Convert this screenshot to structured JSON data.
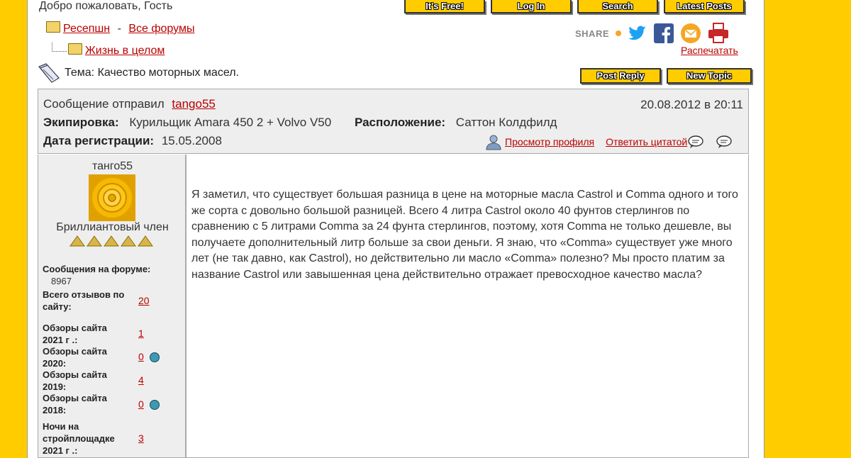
{
  "header": {
    "welcome": "Добро пожаловать, Гость",
    "nav": [
      "It's Free!",
      "Log In",
      "Search",
      "Latest Posts"
    ]
  },
  "breadcrumb": {
    "reception": "Ресепшн",
    "separator": "-",
    "all_forums": "Все форумы",
    "subforum": "Жизнь в целом"
  },
  "topic": {
    "label": "Тема: Качество моторных масел."
  },
  "share": {
    "label": "SHARE",
    "print": "Распечатать",
    "icons": [
      "twitter-icon",
      "facebook-icon",
      "email-icon",
      "printer-icon"
    ]
  },
  "post_buttons": {
    "reply": "Post Reply",
    "new_topic": "New Topic"
  },
  "post": {
    "sent_by_label": "Сообщение отправил",
    "author": "tango55",
    "date": "20.08.2012 в 20:11",
    "equipment_label": "Экипировка:",
    "equipment": "Курильщик Amara 450 2 + Volvo V50",
    "location_label": "Расположение:",
    "location": "Саттон Колдфилд",
    "reg_label": "Дата регистрации:",
    "reg_date": "15.05.2008",
    "view_profile": "Просмотр профиля",
    "reply_quote": "Ответить цитатой",
    "body": "Я заметил, что существует большая разница в цене на моторные масла Castrol и Comma одного и того же сорта с довольно большой разницей. Всего 4 литра Castrol около 40 фунтов стерлингов по сравнению с 5 литрами Comma за 24 фунта стерлингов, поэтому, хотя Comma не только дешевле, вы получаете дополнительный литр больше за свои деньги. Я знаю, что «Comma» существует уже много лет (не так давно, как Castrol), но действительно ли масло «Comma» полезно? Мы просто платим за название Castrol или завышенная цена действительно отражает превосходное качество масла?"
  },
  "user": {
    "name": "танго55",
    "rank": "Бриллиантовый член",
    "forum_posts_label": "Сообщения на форуме:",
    "forum_posts": "8967",
    "total_reviews_label": "Всего отзывов по сайту:",
    "total_reviews": "20",
    "reviews_2021_label": "Обзоры сайта 2021 г .:",
    "reviews_2021": "1",
    "reviews_2020_label": "Обзоры сайта 2020:",
    "reviews_2020": "0",
    "reviews_2019_label": "Обзоры сайта 2019:",
    "reviews_2019": "4",
    "reviews_2018_label": "Обзоры сайта 2018:",
    "reviews_2018": "0",
    "nights_label": "Ночи на стройплощадке 2021 г .:",
    "nights": "3"
  },
  "colors": {
    "background": "#FFCC00",
    "link": "#BB0000",
    "panel": "#EEEEEE"
  }
}
